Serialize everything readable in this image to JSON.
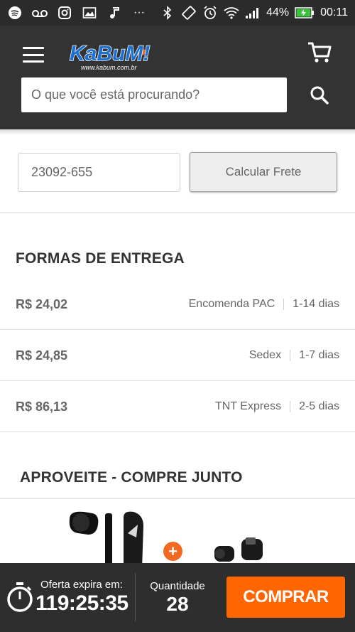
{
  "status_bar": {
    "battery": "44%",
    "time": "00:11",
    "icons": [
      "spotify-icon",
      "voicemail-icon",
      "instagram-icon",
      "image-icon",
      "music-icon",
      "more-icon",
      "bluetooth-icon",
      "rotate-icon",
      "alarm-icon",
      "wifi-icon",
      "signal-icon",
      "battery-icon"
    ]
  },
  "header": {
    "logo_text": "KaBuM!",
    "logo_url_text": "www.kabum.com.br",
    "search_placeholder": "O que você está procurando?"
  },
  "shipping_calc": {
    "cep_value": "23092-655",
    "button_label": "Calcular Frete"
  },
  "delivery": {
    "title": "FORMAS DE ENTREGA",
    "options": [
      {
        "price": "R$ 24,02",
        "method": "Encomenda PAC",
        "eta": "1-14 dias"
      },
      {
        "price": "R$ 24,85",
        "method": "Sedex",
        "eta": "1-7 dias"
      },
      {
        "price": "R$ 86,13",
        "method": "TNT Express",
        "eta": "2-5 dias"
      }
    ]
  },
  "combo": {
    "title": "APROVEITE - COMPRE JUNTO",
    "plus_label": "+"
  },
  "bottom_bar": {
    "offer_label": "Oferta expira em:",
    "offer_time": "119:25:35",
    "qty_label": "Quantidade",
    "qty_value": "28",
    "buy_label": "COMPRAR"
  },
  "colors": {
    "header_bg": "#333333",
    "accent_orange": "#ff6500",
    "logo_blue": "#1a6fd0"
  }
}
